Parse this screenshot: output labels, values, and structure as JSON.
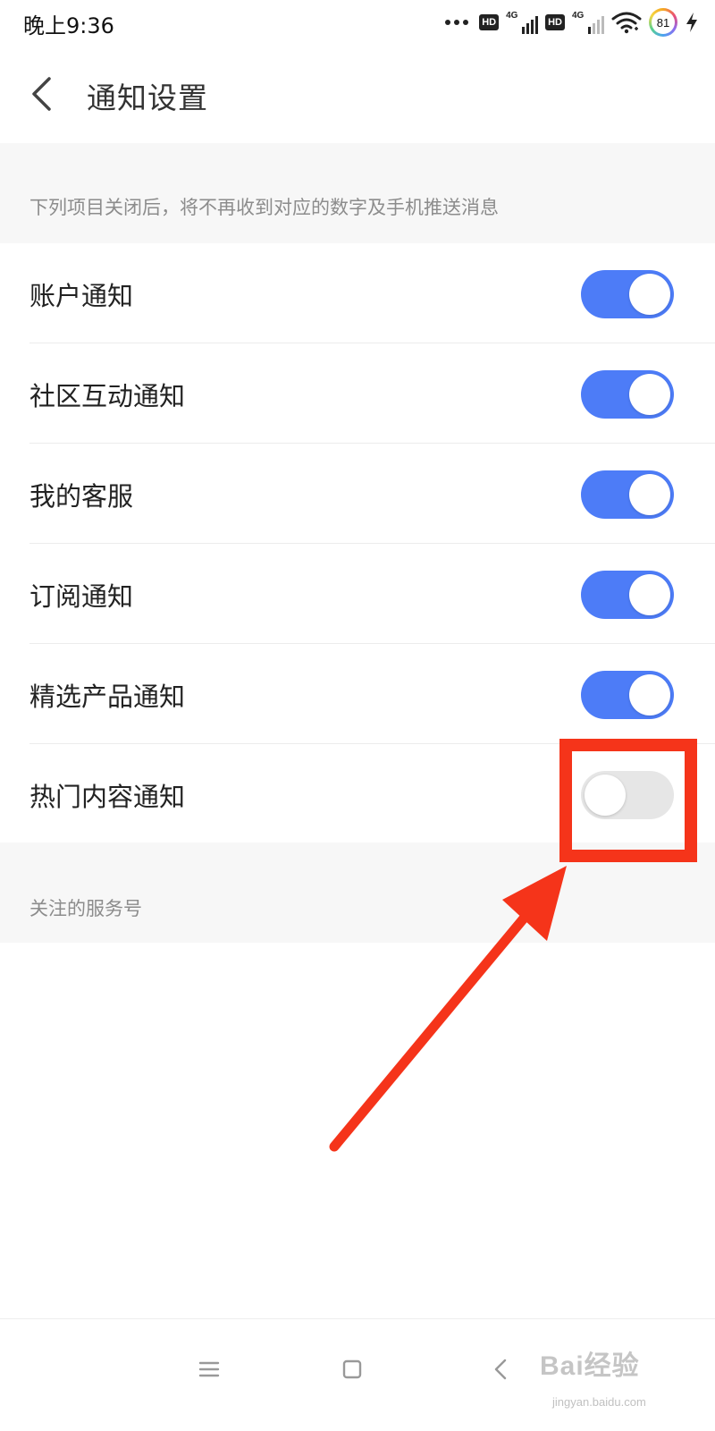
{
  "status_bar": {
    "time": "晚上9:36",
    "hd_badge": "HD",
    "network": "4G",
    "battery": "81"
  },
  "header": {
    "title": "通知设置"
  },
  "notice_hint": "下列项目关闭后，将不再收到对应的数字及手机推送消息",
  "settings": [
    {
      "label": "账户通知",
      "enabled": true
    },
    {
      "label": "社区互动通知",
      "enabled": true
    },
    {
      "label": "我的客服",
      "enabled": true
    },
    {
      "label": "订阅通知",
      "enabled": true
    },
    {
      "label": "精选产品通知",
      "enabled": true
    },
    {
      "label": "热门内容通知",
      "enabled": false
    }
  ],
  "followed_section": "关注的服务号",
  "watermark": {
    "logo": "Bai经验",
    "url": "jingyan.baidu.com"
  },
  "colors": {
    "toggle_on": "#4d7cf7",
    "toggle_off": "#e6e6e6",
    "annotation": "#f5341a"
  }
}
